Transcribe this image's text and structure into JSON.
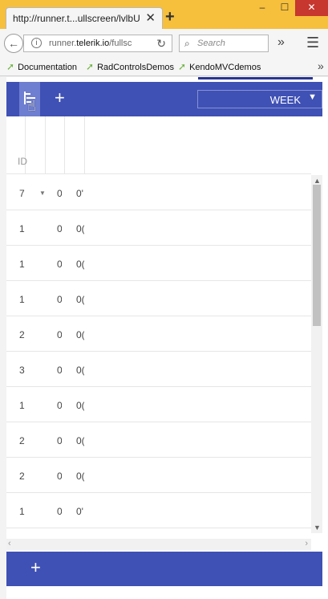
{
  "browser": {
    "tab_title": "http://runner.t...ullscreen/lvlbU",
    "tab_close": "✕",
    "new_tab": "+",
    "window_controls": {
      "minimize": "–",
      "maximize": "☐",
      "close": "✕"
    },
    "url": {
      "prefix": "runner.",
      "domain": "telerik.io",
      "suffix": "/fullsc"
    },
    "search_placeholder": "Search",
    "bookmarks": [
      "Documentation",
      "RadControlsDemos",
      "KendoMVCdemos"
    ],
    "overflow": "»",
    "menu": "☰"
  },
  "toolbar": {
    "add_label": "+",
    "view_selected": "WEEK"
  },
  "grid": {
    "header_id": "ID",
    "rows": [
      {
        "id": "7",
        "expand": "▼",
        "b": "0",
        "c": "0'"
      },
      {
        "id": "1",
        "expand": "",
        "b": "0",
        "c": "0("
      },
      {
        "id": "1",
        "expand": "",
        "b": "0",
        "c": "0("
      },
      {
        "id": "1",
        "expand": "",
        "b": "0",
        "c": "0("
      },
      {
        "id": "2",
        "expand": "",
        "b": "0",
        "c": "0("
      },
      {
        "id": "3",
        "expand": "",
        "b": "0",
        "c": "0("
      },
      {
        "id": "1",
        "expand": "",
        "b": "0",
        "c": "0("
      },
      {
        "id": "2",
        "expand": "",
        "b": "0",
        "c": "0("
      },
      {
        "id": "2",
        "expand": "",
        "b": "0",
        "c": "0("
      },
      {
        "id": "1",
        "expand": "",
        "b": "0",
        "c": "0'"
      }
    ]
  },
  "footer": {
    "add_label": "+"
  }
}
